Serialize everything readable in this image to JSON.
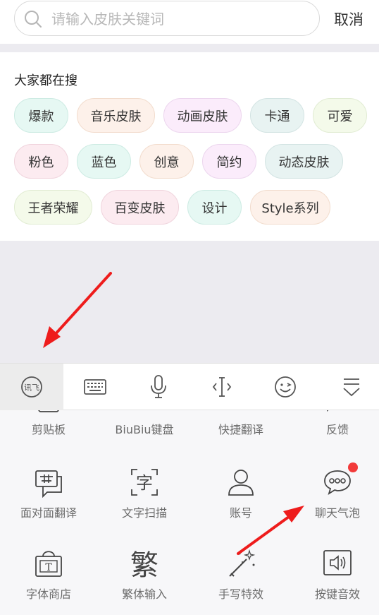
{
  "search": {
    "placeholder": "请输入皮肤关键词",
    "value": "",
    "cancel_label": "取消"
  },
  "hot_search": {
    "title": "大家都在搜",
    "tags": [
      "爆款",
      "音乐皮肤",
      "动画皮肤",
      "卡通",
      "可爱",
      "粉色",
      "蓝色",
      "创意",
      "简约",
      "动态皮肤",
      "王者荣耀",
      "百变皮肤",
      "设计",
      "Style系列"
    ]
  },
  "toolbar": {
    "items": [
      "logo-icon",
      "keyboard-icon",
      "microphone-icon",
      "cursor-icon",
      "emoji-icon",
      "collapse-icon"
    ]
  },
  "functions": {
    "row1": [
      "剪贴板",
      "BiuBiu键盘",
      "快捷翻译",
      "反馈"
    ],
    "row2": [
      "面对面翻译",
      "文字扫描",
      "账号",
      "聊天气泡"
    ],
    "row3": [
      "字体商店",
      "繁体输入",
      "手写特效",
      "按键音效"
    ],
    "icon_text": {
      "scan": "字",
      "traditional": "繁",
      "font_store": "T"
    }
  },
  "colors": {
    "badge": "#f23a3a",
    "arrow": "#ee1c1c"
  }
}
